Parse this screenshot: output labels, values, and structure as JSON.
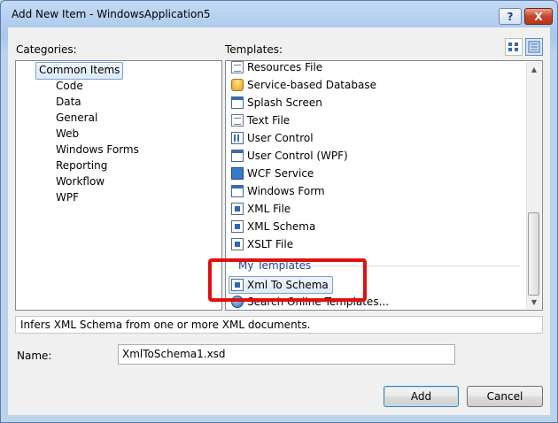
{
  "window": {
    "title": "Add New Item - WindowsApplication5"
  },
  "titlebar": {
    "help_label": "?",
    "close_label": "X"
  },
  "categories": {
    "label": "Categories:",
    "items": [
      {
        "label": "Common Items",
        "selected": true
      },
      {
        "label": "Code"
      },
      {
        "label": "Data"
      },
      {
        "label": "General"
      },
      {
        "label": "Web"
      },
      {
        "label": "Windows Forms"
      },
      {
        "label": "Reporting"
      },
      {
        "label": "Workflow"
      },
      {
        "label": "WPF"
      }
    ]
  },
  "templates": {
    "label": "Templates:",
    "items": [
      {
        "label": "Resources File",
        "icon": "resources-file-icon"
      },
      {
        "label": "Service-based Database",
        "icon": "database-icon"
      },
      {
        "label": "Splash Screen",
        "icon": "splash-screen-icon"
      },
      {
        "label": "Text File",
        "icon": "text-file-icon"
      },
      {
        "label": "User Control",
        "icon": "user-control-icon"
      },
      {
        "label": "User Control (WPF)",
        "icon": "user-control-wpf-icon"
      },
      {
        "label": "WCF Service",
        "icon": "wcf-service-icon"
      },
      {
        "label": "Windows Form",
        "icon": "windows-form-icon"
      },
      {
        "label": "XML File",
        "icon": "xml-file-icon"
      },
      {
        "label": "XML Schema",
        "icon": "xml-schema-icon"
      },
      {
        "label": "XSLT File",
        "icon": "xslt-file-icon"
      }
    ],
    "my_templates": {
      "header": "My Templates",
      "items": [
        {
          "label": "Xml To Schema",
          "icon": "xml-to-schema-icon",
          "selected": true
        },
        {
          "label": "Search Online Templates...",
          "icon": "search-online-icon"
        }
      ]
    }
  },
  "description": "Infers XML Schema from one or more XML documents.",
  "name_field": {
    "label": "Name:",
    "value": "XmlToSchema1.xsd"
  },
  "buttons": {
    "add": "Add",
    "cancel": "Cancel"
  },
  "colors": {
    "highlight": "#e01010",
    "group_header": "#1e3f8c",
    "selection": "#dcebfc"
  }
}
